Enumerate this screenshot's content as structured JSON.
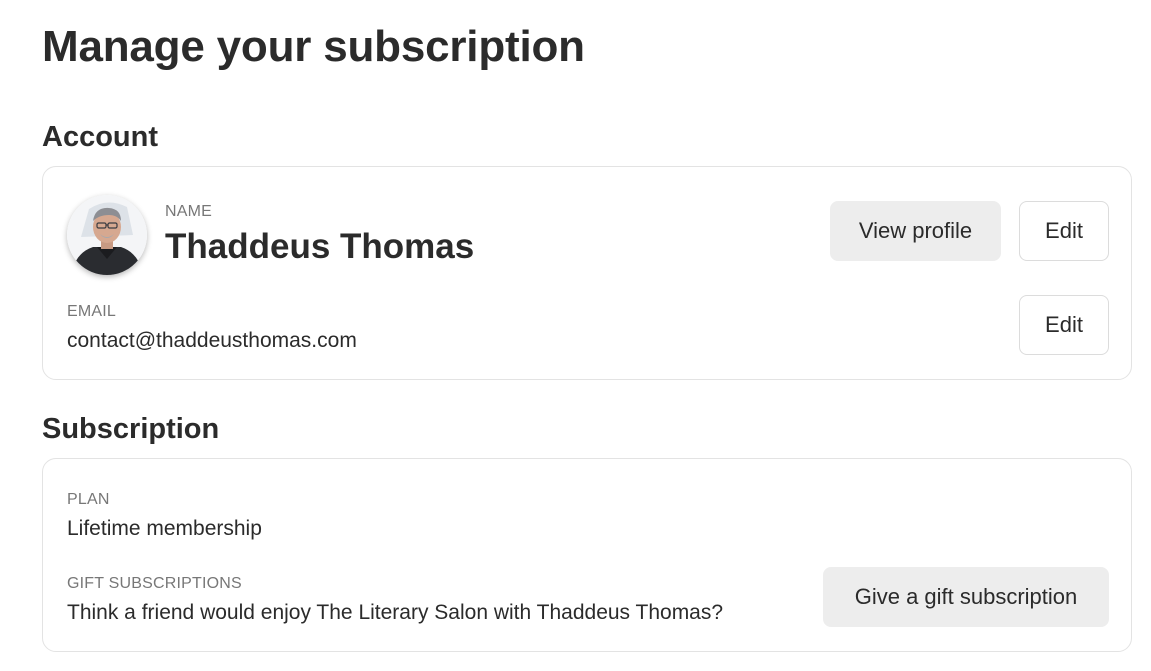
{
  "page": {
    "title": "Manage your subscription"
  },
  "account": {
    "heading": "Account",
    "name_label": "NAME",
    "name_value": "Thaddeus Thomas",
    "email_label": "EMAIL",
    "email_value": "contact@thaddeusthomas.com",
    "view_profile_label": "View profile",
    "edit_name_label": "Edit",
    "edit_email_label": "Edit",
    "avatar_icon": "user-photo-avatar"
  },
  "subscription": {
    "heading": "Subscription",
    "plan_label": "PLAN",
    "plan_value": "Lifetime membership",
    "gift_label": "GIFT SUBSCRIPTIONS",
    "gift_value": "Think a friend would enjoy The Literary Salon with Thaddeus Thomas?",
    "gift_button_label": "Give a gift subscription"
  },
  "colors": {
    "text": "#2b2b2b",
    "muted": "#777777",
    "border": "#e3e3e3",
    "button_fill": "#ededed"
  }
}
